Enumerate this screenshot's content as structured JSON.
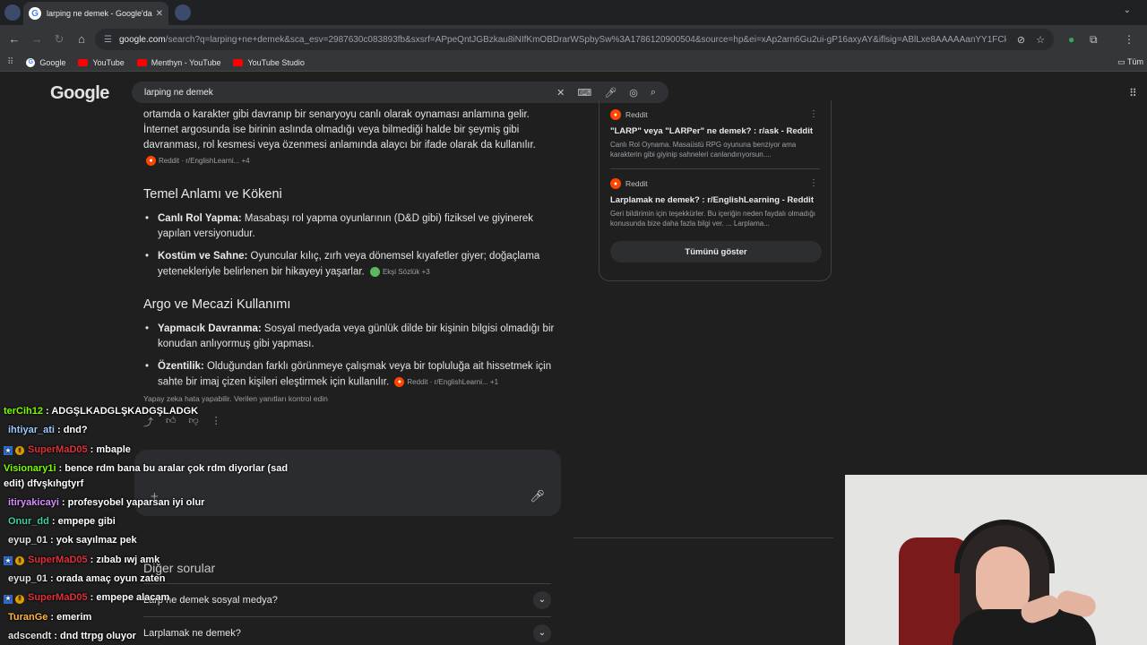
{
  "browser": {
    "tab_title": "larping ne demek - Google'da A",
    "url_host": "google.com",
    "url_rest": "/search?q=larping+ne+demek&sca_esv=2987630c083893fb&sxsrf=APpeQntJGBzkau8iNIfKmOBDrarWSpbySw%3A1786120900504&source=hp&ei=xAp2arn6Gu2ui-gP16axyAY&iflsig=ABlLxe8AAAAAanYY1FCk_Uc6G...",
    "bookmarks": [
      "Google",
      "YouTube",
      "Menthyn - YouTube",
      "YouTube Studio"
    ],
    "bookmarks_right": "Tüm"
  },
  "search": {
    "logo": "Google",
    "query": "larping ne demek"
  },
  "ai_overview": {
    "intro": "ortamda o karakter gibi davranıp bir senaryoyu canlı olarak oynaması anlamına gelir. İnternet argosunda ise birinin aslında olmadığı veya bilmediği halde bir şeymiş gibi davranması, rol kesmesi veya özenmesi anlamında alaycı bir ifade olarak da kullanılır.",
    "intro_chip": "Reddit · r/EnglishLearni... +4",
    "section1_title": "Temel Anlamı ve Kökeni",
    "section1_items": [
      {
        "label": "Canlı Rol Yapma:",
        "text": " Masabaşı rol yapma oyunlarının (D&D gibi) fiziksel ve giyinerek yapılan versiyonudur.",
        "chip": ""
      },
      {
        "label": "Kostüm ve Sahne:",
        "text": " Oyuncular kılıç, zırh veya dönemsel kıyafetler giyer; doğaçlama yetenekleriyle belirlenen bir hikayeyi yaşarlar.",
        "chip": "Ekşi Sözlük +3"
      }
    ],
    "section2_title": "Argo ve Mecazi Kullanımı",
    "section2_items": [
      {
        "label": "Yapmacık Davranma:",
        "text": " Sosyal medyada veya günlük dilde bir kişinin bilgisi olmadığı bir konudan anlıyormuş gibi yapması.",
        "chip": ""
      },
      {
        "label": "Özentilik:",
        "text": " Olduğundan farklı görünmeye çalışmak veya bir topluluğa ait hissetmek için sahte bir imaj çizen kişileri eleştirmek için kullanılır.",
        "chip": "Reddit · r/EnglishLearni... +1"
      }
    ],
    "disclaimer": "Yapay zeka hata yapabilir. Verilen yanıtları kontrol edin"
  },
  "sources": {
    "items": [
      {
        "site": "Reddit",
        "title": "\"LARP\" veya \"LARPer\" ne demek? : r/ask - Reddit",
        "snippet": "Canlı Rol Oynama. Masaüstü RPG oyununa benziyor ama karakterin gibi giyinip sahneleri canlandırıyorsun...."
      },
      {
        "site": "Reddit",
        "title": "Larplamak ne demek? : r/EnglishLearning - Reddit",
        "snippet": "Geri bildirimin için teşekkürler. Bu içeriğin neden faydalı olmadığı konusunda bize daha fazla bilgi ver. ... Larplama..."
      }
    ],
    "show_all": "Tümünü göster"
  },
  "paa": {
    "title": "Diğer sorular",
    "items": [
      "Larp ne demek sosyal medya?",
      "Larplamak ne demek?"
    ]
  },
  "chat": [
    {
      "user": "terCih12",
      "color": "#7cfc00",
      "badges": [],
      "text": "ADGŞLKADGLŞKADGŞLADGK"
    },
    {
      "user": "ihtiyar_ati",
      "color": "#9ecbff",
      "badges": [
        "dot"
      ],
      "text": "dnd?"
    },
    {
      "user": "SuperMaD05",
      "color": "#e0303a",
      "badges": [
        "star",
        "warn"
      ],
      "text": "mbaple"
    },
    {
      "user": "Visionary1i",
      "color": "#7cfc00",
      "badges": [],
      "text": "bence rdm bana bu aralar çok rdm diyorlar (sad edit) dfvşkıhgtyrf",
      "wrap": true
    },
    {
      "user": "itiryakicayi",
      "color": "#d78cff",
      "badges": [
        "dot"
      ],
      "text": "profesyobel yaparsan iyi olur"
    },
    {
      "user": "Onur_dd",
      "color": "#3fd0a0",
      "badges": [
        "dot"
      ],
      "text": "empepe gibi"
    },
    {
      "user": "eyup_01",
      "color": "#e3e3e3",
      "badges": [
        "dot"
      ],
      "text": "yok sayılmaz pek"
    },
    {
      "user": "SuperMaD05",
      "color": "#e0303a",
      "badges": [
        "star",
        "warn"
      ],
      "text": "zıbab ıwj amk"
    },
    {
      "user": "eyup_01",
      "color": "#e3e3e3",
      "badges": [
        "dot"
      ],
      "text": "orada amaç oyun zaten"
    },
    {
      "user": "SuperMaD05",
      "color": "#e0303a",
      "badges": [
        "star",
        "warn"
      ],
      "text": "empepe alacam"
    },
    {
      "user": "TuranGe",
      "color": "#ffb347",
      "badges": [
        "dot"
      ],
      "text": "emerim"
    },
    {
      "user": "adscendt",
      "color": "#e3e3e3",
      "badges": [
        "dot"
      ],
      "text": "dnd ttrpg oluyor"
    }
  ]
}
